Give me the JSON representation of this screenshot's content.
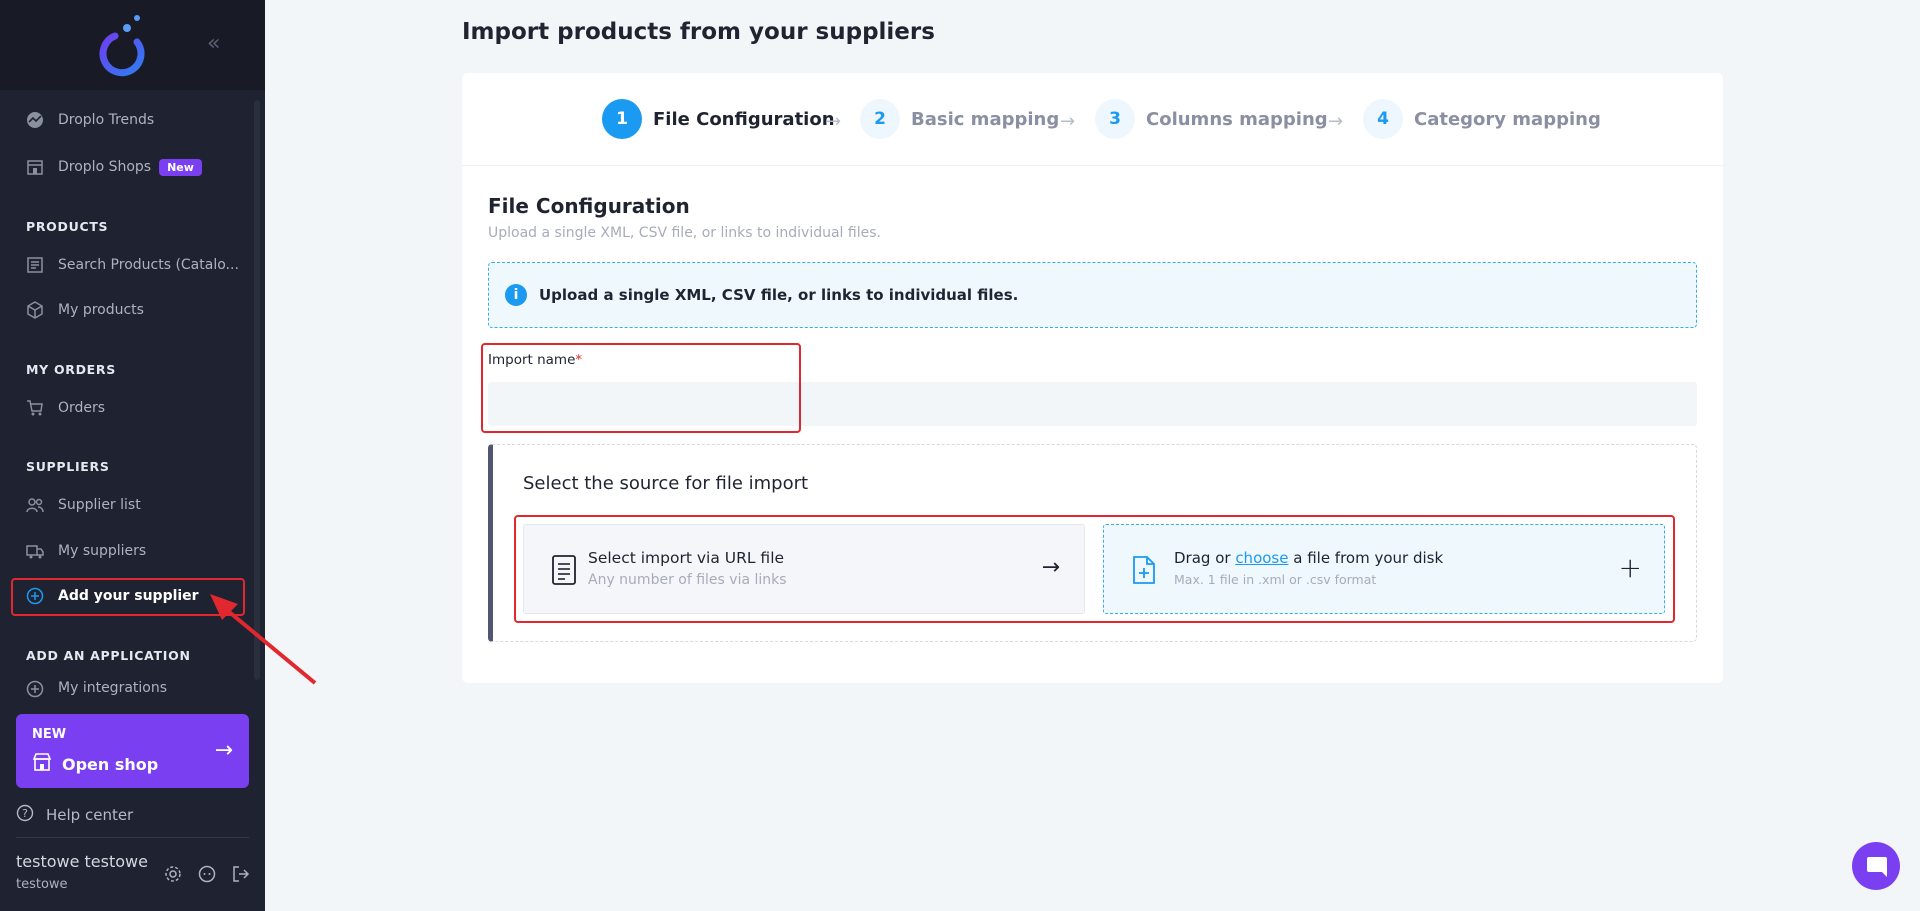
{
  "sidebar": {
    "collapse_icon": "double-chevron-left-icon",
    "nav_top": [
      {
        "label": "Droplo Trends",
        "icon": "trends-icon"
      },
      {
        "label": "Droplo Shops",
        "icon": "shop-icon",
        "badge": "New"
      }
    ],
    "sections": [
      {
        "heading": "PRODUCTS",
        "items": [
          {
            "label": "Search Products (Catalo...",
            "icon": "catalog-icon"
          },
          {
            "label": "My products",
            "icon": "box-icon"
          }
        ]
      },
      {
        "heading": "MY ORDERS",
        "items": [
          {
            "label": "Orders",
            "icon": "cart-icon"
          }
        ]
      },
      {
        "heading": "SUPPLIERS",
        "items": [
          {
            "label": "Supplier list",
            "icon": "users-icon"
          },
          {
            "label": "My suppliers",
            "icon": "truck-icon"
          },
          {
            "label": "Add your supplier",
            "icon": "plus-circle-icon",
            "active": true
          }
        ]
      },
      {
        "heading": "ADD AN APPLICATION",
        "items": [
          {
            "label": "My integrations",
            "icon": "plus-circle-icon"
          }
        ]
      }
    ],
    "promo": {
      "tag": "NEW",
      "title": "Open shop"
    },
    "help": "Help center",
    "user": {
      "name": "testowe testowe",
      "sub": "testowe"
    }
  },
  "page": {
    "title": "Import products from your suppliers"
  },
  "stepper": [
    {
      "num": "1",
      "label": "File Configuration",
      "active": true
    },
    {
      "num": "2",
      "label": "Basic mapping",
      "active": false
    },
    {
      "num": "3",
      "label": "Columns mapping",
      "active": false
    },
    {
      "num": "4",
      "label": "Category mapping",
      "active": false
    }
  ],
  "config": {
    "title": "File Configuration",
    "subtitle": "Upload a single XML, CSV file, or links to individual files.",
    "info": "Upload a single XML, CSV file, or links to individual files.",
    "import_name_label": "Import name",
    "required_mark": "*",
    "import_name_value": "",
    "import_name_placeholder": ""
  },
  "source": {
    "title": "Select the source for file import",
    "url_option": {
      "title": "Select import via URL file",
      "subtitle": "Any number of files via links"
    },
    "file_option": {
      "pre": "Drag or ",
      "link": "choose",
      "post": " a file from your disk",
      "subtitle": "Max. 1 file in .xml or .csv format"
    }
  },
  "colors": {
    "accent": "#1a9af0",
    "brand": "#7b3ff2",
    "highlight": "#e0282e",
    "sidebar": "#1f2230"
  }
}
